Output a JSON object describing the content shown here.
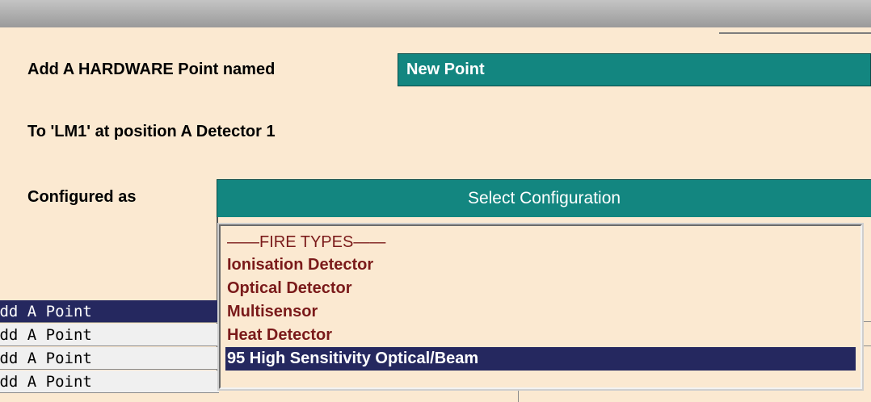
{
  "form": {
    "add_label": "Add A HARDWARE Point named",
    "name_value": "New Point",
    "location_label": "To 'LM1' at position A Detector 1",
    "configured_label": "Configured as",
    "select_button_label": "Select Configuration"
  },
  "config_list": {
    "items": [
      {
        "label": "——FIRE TYPES——",
        "header": true
      },
      {
        "label": "Ionisation Detector"
      },
      {
        "label": "Optical Detector"
      },
      {
        "label": "Multisensor"
      },
      {
        "label": "Heat Detector"
      },
      {
        "label": "95 High Sensitivity Optical/Beam",
        "selected": true
      }
    ]
  },
  "background_list": {
    "rows": [
      {
        "label": "Add A Point",
        "selected": true
      },
      {
        "label": "Add A Point"
      },
      {
        "label": "Add A Point"
      },
      {
        "label": "Add A Point"
      }
    ]
  },
  "colors": {
    "teal": "#138680",
    "panel_bg": "#fbe9d1",
    "selection": "#25285f",
    "list_text": "#7a1a1a"
  }
}
